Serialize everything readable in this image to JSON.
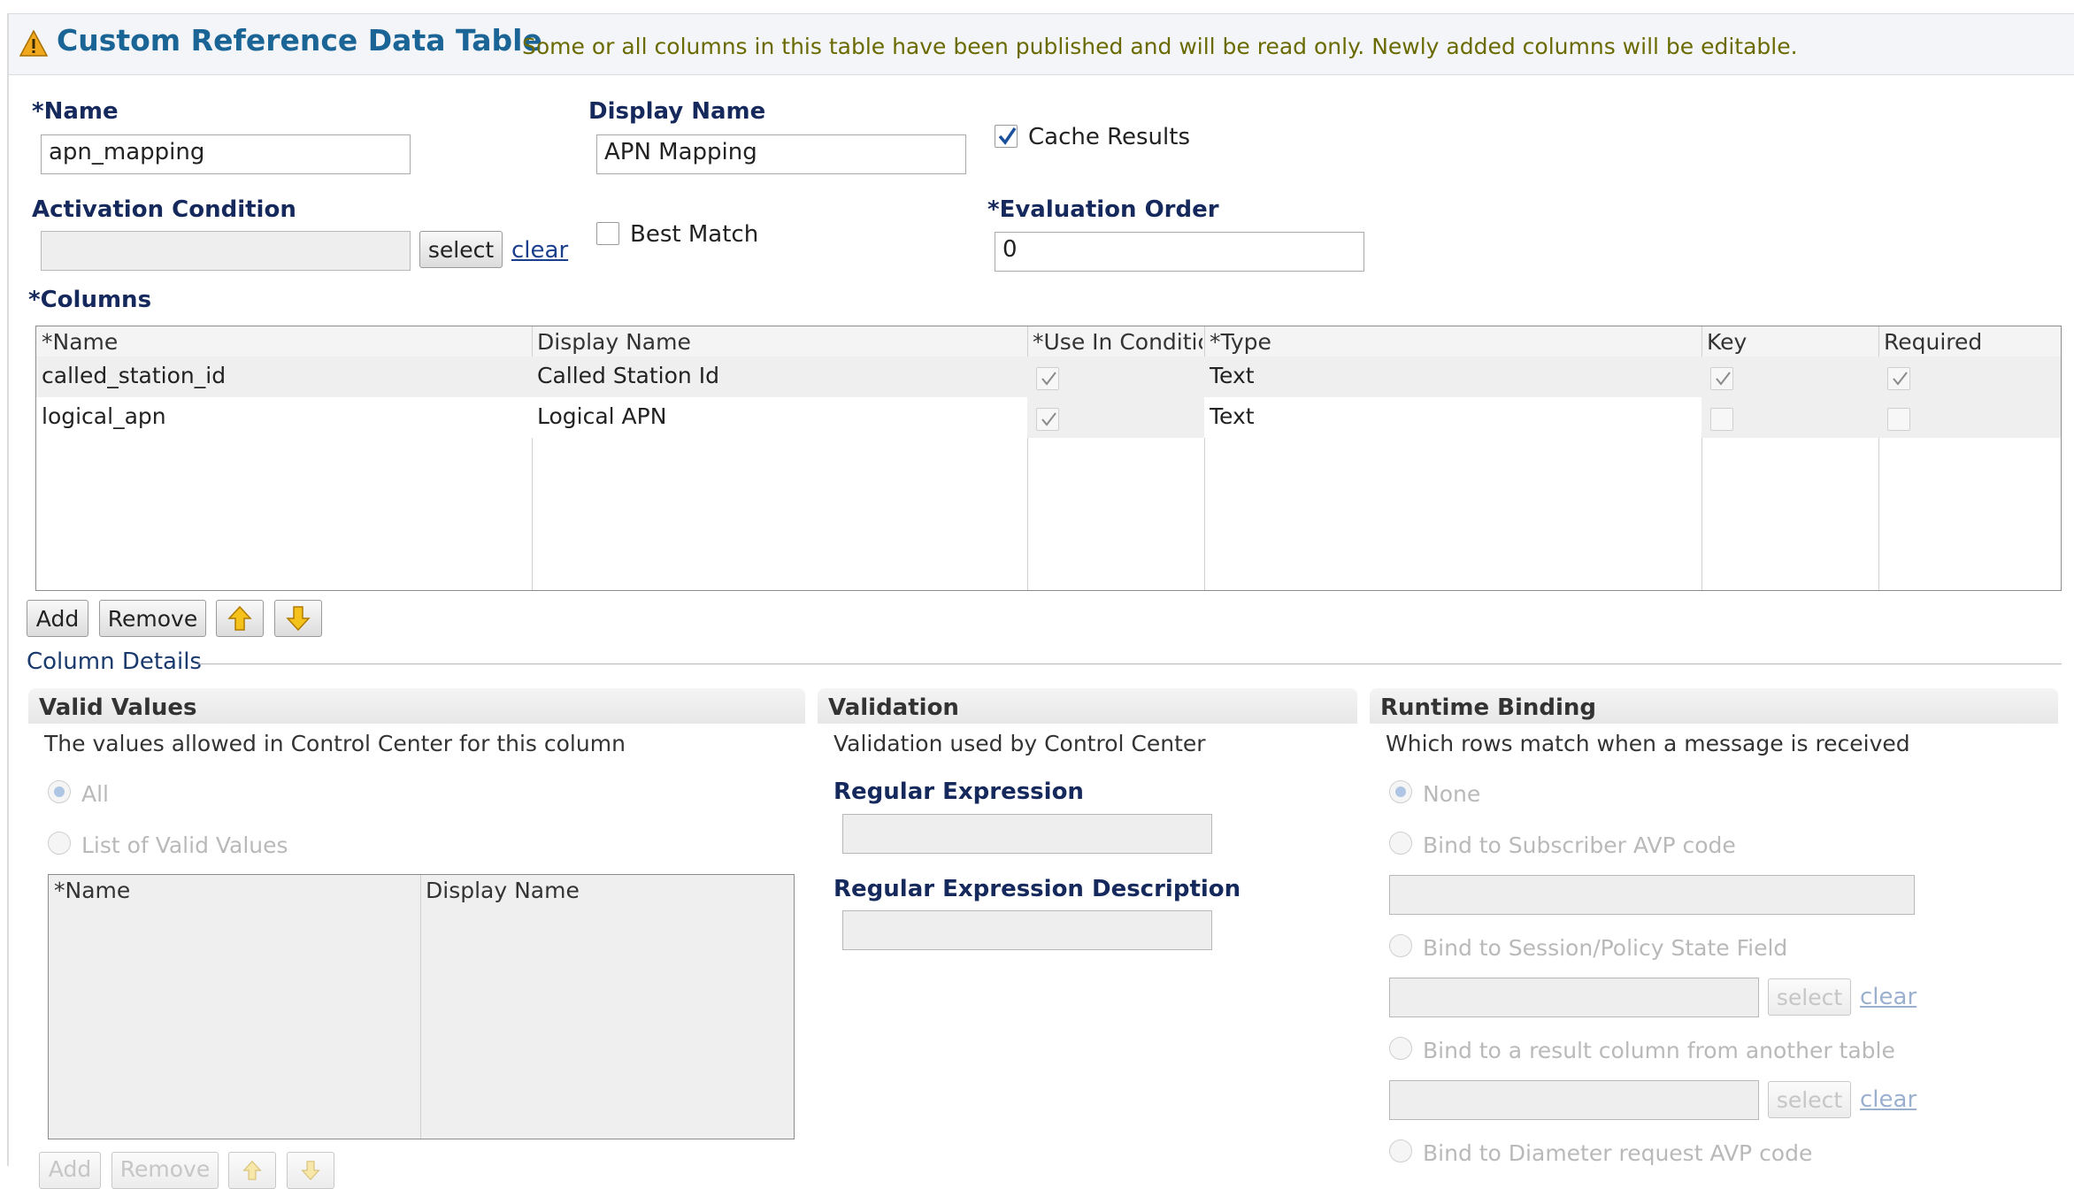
{
  "header": {
    "title": "Custom Reference Data Table",
    "notice": "Some or all columns in this table have been published and will be read only.  Newly added columns will be editable."
  },
  "form": {
    "name_label": "*Name",
    "name_value": "apn_mapping",
    "display_name_label": "Display Name",
    "display_name_value": "APN Mapping",
    "cache_results_label": "Cache Results",
    "cache_results_checked": true,
    "activation_condition_label": "Activation Condition",
    "activation_condition_value": "",
    "select_label": "select",
    "clear_label": "clear",
    "best_match_label": "Best Match",
    "best_match_checked": false,
    "evaluation_order_label": "*Evaluation Order",
    "evaluation_order_value": "0"
  },
  "columns": {
    "label": "*Columns",
    "headers": [
      "*Name",
      "Display Name",
      "*Use In Conditic",
      "*Type",
      "Key",
      "Required"
    ],
    "rows": [
      {
        "name": "called_station_id",
        "display_name": "Called Station Id",
        "use_in_condition": true,
        "type": "Text",
        "key": true,
        "required": true
      },
      {
        "name": "logical_apn",
        "display_name": "Logical APN",
        "use_in_condition": true,
        "type": "Text",
        "key": false,
        "required": false
      }
    ],
    "buttons": {
      "add": "Add",
      "remove": "Remove",
      "move_up_icon": "arrow-up-icon",
      "move_down_icon": "arrow-down-icon"
    }
  },
  "column_details": {
    "label": "Column Details",
    "valid_values": {
      "title": "Valid Values",
      "description": "The values allowed in Control Center for this column",
      "option_all": "All",
      "option_list": "List of Valid Values",
      "selected": "All",
      "table_headers": [
        "*Name",
        "Display Name"
      ],
      "buttons": {
        "add": "Add",
        "remove": "Remove"
      }
    },
    "validation": {
      "title": "Validation",
      "description": "Validation used by Control Center",
      "regex_label": "Regular Expression",
      "regex_value": "",
      "regex_desc_label": "Regular Expression Description",
      "regex_desc_value": ""
    },
    "runtime_binding": {
      "title": "Runtime Binding",
      "description": "Which rows match when a message is received",
      "selected": "None",
      "options": {
        "none": "None",
        "subscriber_avp": "Bind to Subscriber AVP code",
        "session_policy": "Bind to Session/Policy State Field",
        "result_column": "Bind to a result column from another table",
        "diameter_avp": "Bind to Diameter request AVP code"
      },
      "select_label": "select",
      "clear_label": "clear"
    }
  },
  "colors": {
    "title": "#1a6496",
    "label": "#15295c",
    "notice": "#6a6a00",
    "warning": "#f0a81e",
    "arrow": "#f5c21b"
  }
}
